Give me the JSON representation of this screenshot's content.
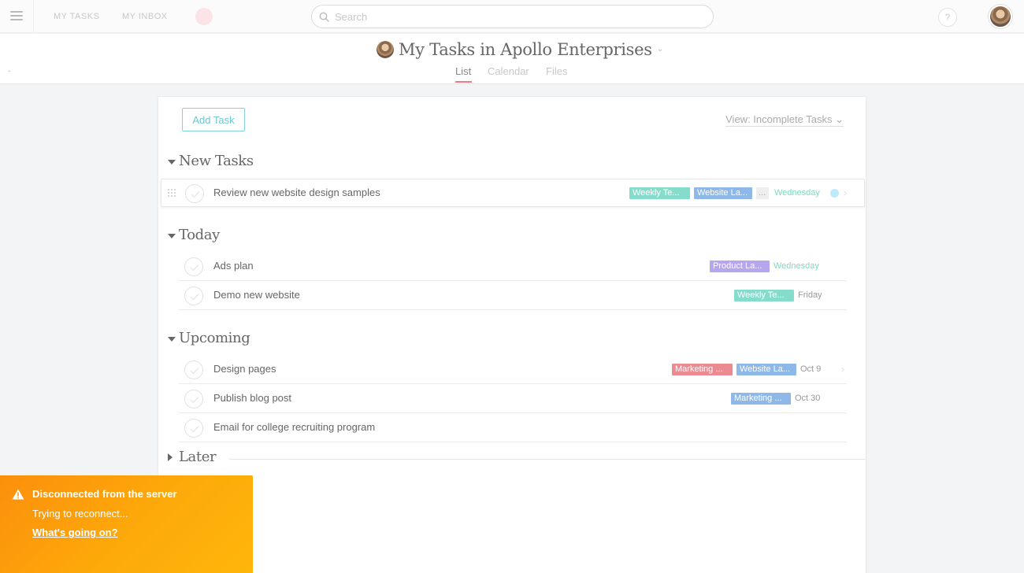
{
  "topbar": {
    "my_tasks": "MY TASKS",
    "my_inbox": "MY INBOX",
    "search_placeholder": "Search",
    "help": "?"
  },
  "header": {
    "title": "My Tasks in Apollo Enterprises",
    "tabs": [
      {
        "label": "List",
        "active": true
      },
      {
        "label": "Calendar",
        "active": false
      },
      {
        "label": "Files",
        "active": false
      }
    ]
  },
  "toolbar": {
    "add_task": "Add Task",
    "view": "View: Incomplete Tasks ⌄"
  },
  "colors": {
    "teal_tag": "#85dccb",
    "blue_tag": "#8db8e8",
    "purple_tag": "#b6a6ee",
    "red_tag": "#ec8a91",
    "green_date": "#7fd9bd",
    "accent_pink": "#f27a86",
    "alert_orange": "#fc9a0b"
  },
  "sections": [
    {
      "title": "New Tasks",
      "tasks": [
        {
          "name": "Review new website design samples",
          "tags": [
            {
              "label": "Weekly Te...",
              "color": "#85dccb"
            },
            {
              "label": "Website La...",
              "color": "#8db8e8"
            }
          ],
          "more_tags": "...",
          "due": "Wednesday",
          "due_green": true
        }
      ]
    },
    {
      "title": "Today",
      "tasks": [
        {
          "name": "Ads plan",
          "tags": [
            {
              "label": "Product La...",
              "color": "#b6a6ee"
            }
          ],
          "due": "Wednesday",
          "due_green": true
        },
        {
          "name": "Demo new website",
          "tags": [
            {
              "label": "Weekly Te...",
              "color": "#85dccb"
            }
          ],
          "due": "Friday",
          "due_green": false
        }
      ]
    },
    {
      "title": "Upcoming",
      "tasks": [
        {
          "name": "Design pages",
          "tags": [
            {
              "label": "Marketing ...",
              "color": "#ec8a91"
            },
            {
              "label": "Website La...",
              "color": "#8db8e8"
            }
          ],
          "due": "Oct 9",
          "due_green": false
        },
        {
          "name": "Publish blog post",
          "tags": [
            {
              "label": "Marketing ...",
              "color": "#8db8e8"
            }
          ],
          "due": "Oct 30",
          "due_green": false
        },
        {
          "name": "Email for college recruiting program",
          "tags": [],
          "due": "",
          "due_green": false
        }
      ]
    },
    {
      "title": "Later",
      "tasks": []
    }
  ],
  "notification": {
    "title": "Disconnected from the server",
    "subtitle": "Trying to reconnect...",
    "link": "What's going on?"
  }
}
